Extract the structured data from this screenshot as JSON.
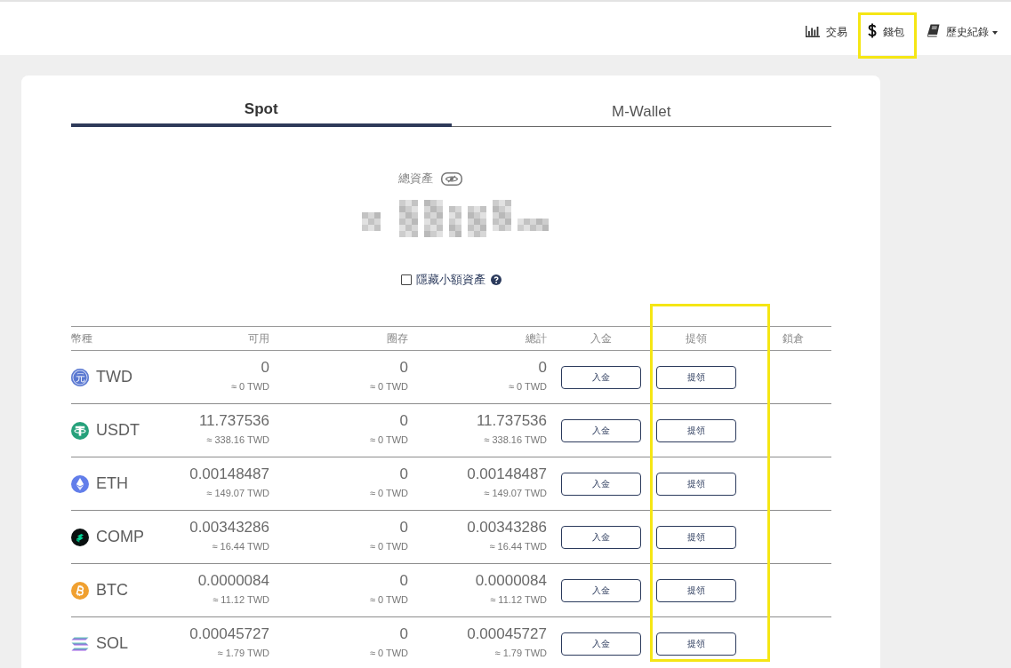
{
  "nav": {
    "items": [
      {
        "kind": "chart",
        "label": "交易",
        "highlighted": false,
        "dropdown": false
      },
      {
        "kind": "dollar",
        "label": "錢包",
        "highlighted": true,
        "dropdown": false
      },
      {
        "kind": "book",
        "label": "歷史紀錄",
        "highlighted": false,
        "dropdown": true
      }
    ]
  },
  "tabs": [
    {
      "label": "Spot",
      "selected": true
    },
    {
      "label": "M-Wallet",
      "selected": false
    }
  ],
  "summary": {
    "label": "總資產",
    "hide_small": {
      "label": "隱藏小額資產",
      "checked": false
    }
  },
  "table": {
    "columns": [
      {
        "label": "幣種",
        "highlighted": false
      },
      {
        "label": "可用",
        "highlighted": false
      },
      {
        "label": "圈存",
        "highlighted": false
      },
      {
        "label": "總計",
        "highlighted": false
      },
      {
        "label": "入金",
        "highlighted": false
      },
      {
        "label": "提領",
        "highlighted": true
      },
      {
        "label": "鎖倉",
        "highlighted": false
      }
    ],
    "rows": [
      {
        "coin": "TWD",
        "kind": "glyph",
        "glyph": "元",
        "available": "0",
        "available_twd": "≈ 0 TWD",
        "frozen": "0",
        "frozen_twd": "≈ 0 TWD",
        "total": "0",
        "total_twd": "≈ 0 TWD",
        "deposit": "入金",
        "withdraw": "提領"
      },
      {
        "coin": "USDT",
        "kind": "tether",
        "available": "11.737536",
        "available_twd": "≈ 338.16 TWD",
        "frozen": "0",
        "frozen_twd": "≈ 0 TWD",
        "total": "11.737536",
        "total_twd": "≈ 338.16 TWD",
        "deposit": "入金",
        "withdraw": "提領"
      },
      {
        "coin": "ETH",
        "kind": "diamond",
        "available": "0.00148487",
        "available_twd": "≈ 149.07 TWD",
        "frozen": "0",
        "frozen_twd": "≈ 0 TWD",
        "total": "0.00148487",
        "total_twd": "≈ 149.07 TWD",
        "deposit": "入金",
        "withdraw": "提領"
      },
      {
        "coin": "COMP",
        "kind": "stack",
        "available": "0.00343286",
        "available_twd": "≈ 16.44 TWD",
        "frozen": "0",
        "frozen_twd": "≈ 0 TWD",
        "total": "0.00343286",
        "total_twd": "≈ 16.44 TWD",
        "deposit": "入金",
        "withdraw": "提領"
      },
      {
        "coin": "BTC",
        "kind": "bitcoin",
        "available": "0.0000084",
        "available_twd": "≈ 11.12 TWD",
        "frozen": "0",
        "frozen_twd": "≈ 0 TWD",
        "total": "0.0000084",
        "total_twd": "≈ 11.12 TWD",
        "deposit": "入金",
        "withdraw": "提領"
      },
      {
        "coin": "SOL",
        "kind": "bars",
        "available": "0.00045727",
        "available_twd": "≈ 1.79 TWD",
        "frozen": "0",
        "frozen_twd": "≈ 0 TWD",
        "total": "0.00045727",
        "total_twd": "≈ 1.79 TWD",
        "deposit": "入金",
        "withdraw": "提領"
      }
    ]
  }
}
